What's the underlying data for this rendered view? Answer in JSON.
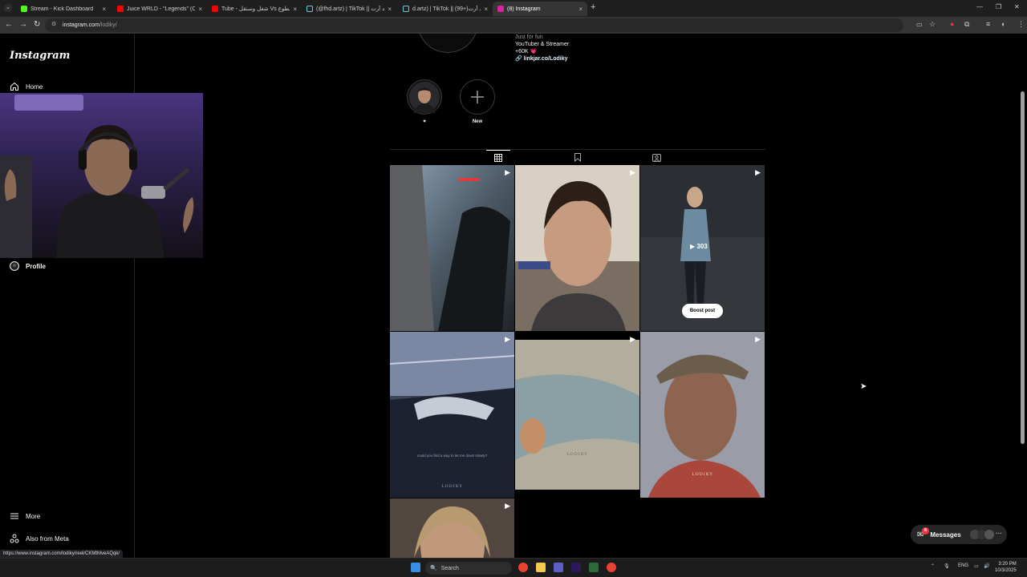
{
  "browser": {
    "tabs": [
      {
        "title": "Stream - Kick Dashboard",
        "fav": "#53fc18",
        "close": "×"
      },
      {
        "title": "Juice WRLD - \"Legends\" (Offici",
        "fav": "#ff0000",
        "close": "×"
      },
      {
        "title": "Tube - شغل وسنقل Vs ملطوع",
        "fav": "#ff0000",
        "close": "×"
      },
      {
        "title": "(@fhd.artz) | TikTok || فهد آرت",
        "fav": "#222222",
        "close": "×"
      },
      {
        "title": "d.artz) | TikTok || (99+)فهد آرت",
        "fav": "#222222",
        "close": "×"
      },
      {
        "title": "(8) Instagram",
        "fav": "#d6249f",
        "close": "×"
      }
    ],
    "new_tab": "+",
    "url_host": "instagram.com",
    "url_path": "/lodiky/",
    "window_controls": [
      "—",
      "❐",
      "✕"
    ]
  },
  "sidebar": {
    "logo": "Instagram",
    "home": "Home",
    "profile": "Profile",
    "more": "More",
    "meta": "Also from Meta"
  },
  "profile": {
    "bio_line0": "Just for fun",
    "bio_line1": "YouTuber & Streamer",
    "bio_line2": "+60K 💗",
    "bio_link": "linkjar.co/Lodiky"
  },
  "highlights": [
    {
      "label": "♥"
    },
    {
      "label": "New"
    }
  ],
  "posts": {
    "plays": "303",
    "boost": "Boost post",
    "caption_5": "could you find a way to let me down slowly?",
    "watermark": "LODIKY"
  },
  "messages": {
    "label": "Messages",
    "badge": "8"
  },
  "status_url": "https://www.instagram.com/lodiky/reel/CKMtMveAQqk/",
  "taskbar": {
    "search": "Search",
    "lang": "ENG",
    "time": "3:20 PM",
    "date": "10/3/2025"
  }
}
